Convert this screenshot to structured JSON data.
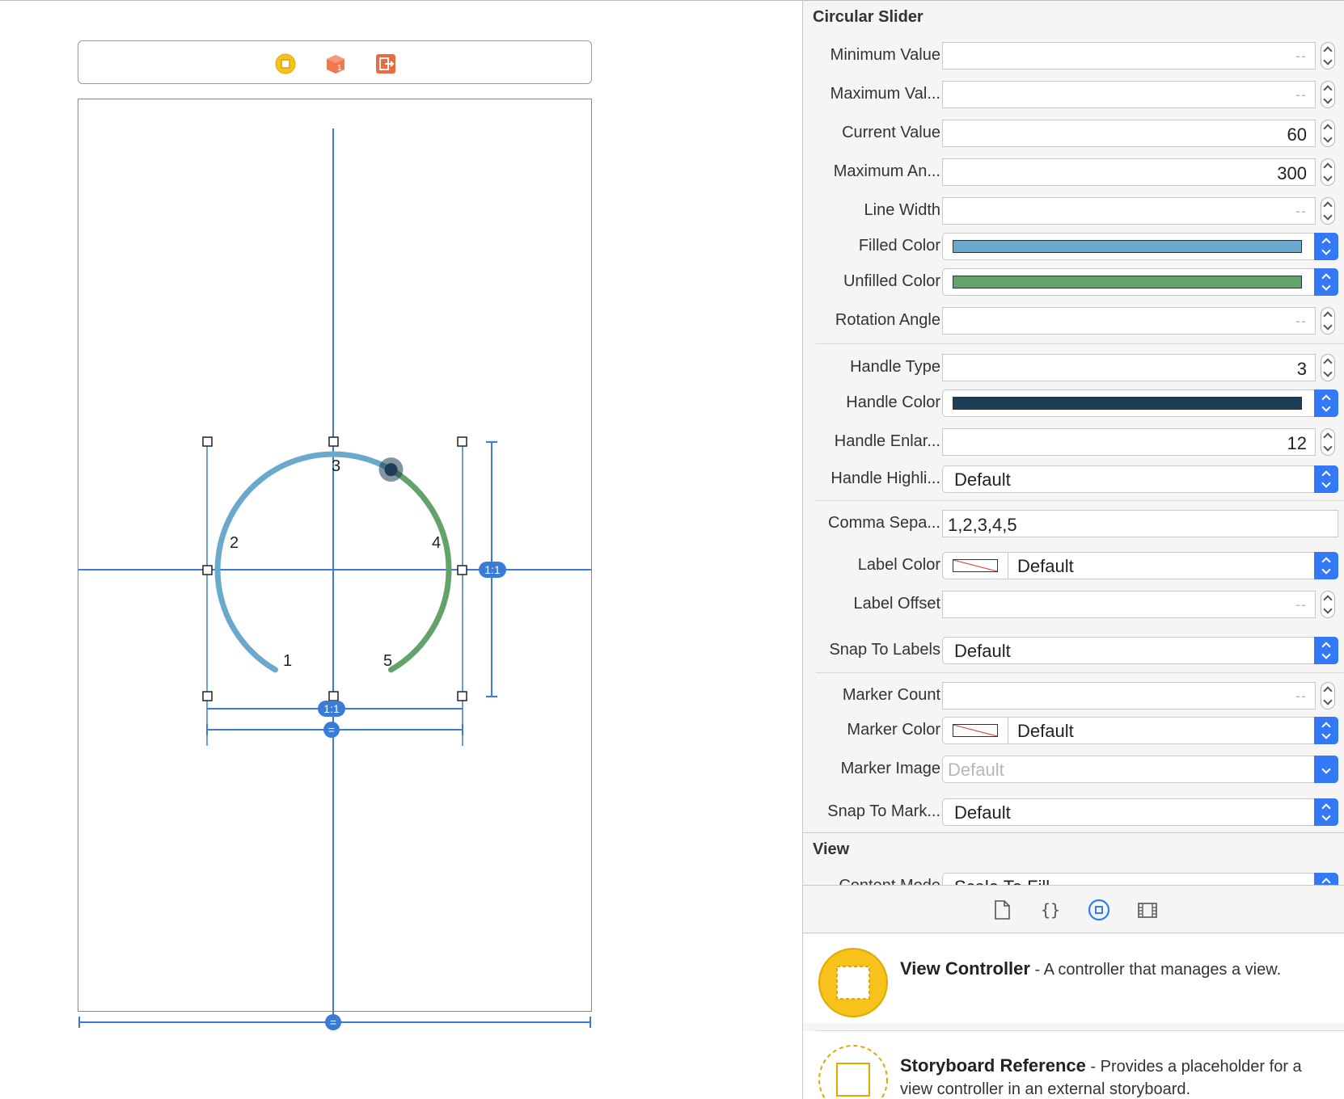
{
  "canvas": {
    "dock_icons": [
      "view-controller-icon",
      "first-responder-icon",
      "exit-icon"
    ],
    "slider_labels": [
      "1",
      "2",
      "3",
      "4",
      "5"
    ],
    "constraint_badges": [
      "1:1",
      "1:1",
      "=",
      "="
    ],
    "colors": {
      "filled": "#6aa9cb",
      "unfilled": "#62a26b",
      "handle": "#1d3c55",
      "guide": "#3a7bd5"
    }
  },
  "inspector": {
    "section_title": "Circular Slider",
    "rows": {
      "minimum_value": {
        "label": "Minimum Value",
        "value": "--"
      },
      "maximum_value": {
        "label": "Maximum Val...",
        "value": "--"
      },
      "current_value": {
        "label": "Current Value",
        "value": "60"
      },
      "maximum_angle": {
        "label": "Maximum An...",
        "value": "300"
      },
      "line_width": {
        "label": "Line Width",
        "value": "--"
      },
      "filled_color": {
        "label": "Filled Color",
        "color": "#6aa9cb"
      },
      "unfilled_color": {
        "label": "Unfilled Color",
        "color": "#62a26b"
      },
      "rotation_angle": {
        "label": "Rotation Angle",
        "value": "--"
      },
      "handle_type": {
        "label": "Handle Type",
        "value": "3"
      },
      "handle_color": {
        "label": "Handle Color",
        "color": "#1d3c55"
      },
      "handle_enlargement": {
        "label": "Handle Enlar...",
        "value": "12"
      },
      "handle_highlight": {
        "label": "Handle Highli...",
        "value": "Default"
      },
      "comma_separated": {
        "label": "Comma Sepa...",
        "value": "1,2,3,4,5"
      },
      "label_color": {
        "label": "Label Color",
        "value": "Default"
      },
      "label_offset": {
        "label": "Label Offset",
        "value": "--"
      },
      "snap_to_labels": {
        "label": "Snap To Labels",
        "value": "Default"
      },
      "marker_count": {
        "label": "Marker Count",
        "value": "--"
      },
      "marker_color": {
        "label": "Marker Color",
        "value": "Default"
      },
      "marker_image": {
        "label": "Marker Image",
        "value": "Default"
      },
      "snap_to_markers": {
        "label": "Snap To Mark...",
        "value": "Default"
      }
    },
    "view_section_title": "View",
    "content_mode": {
      "label": "Content Mode",
      "value": "Scale To Fill"
    }
  },
  "library": {
    "tabs": [
      "file-icon",
      "braces-icon",
      "object-library-icon",
      "media-library-icon"
    ],
    "items": [
      {
        "name": "View Controller",
        "description": " - A controller that manages a view."
      },
      {
        "name": "Storyboard Reference",
        "description": " - Provides a placeholder for a view controller in an external storyboard."
      }
    ]
  }
}
